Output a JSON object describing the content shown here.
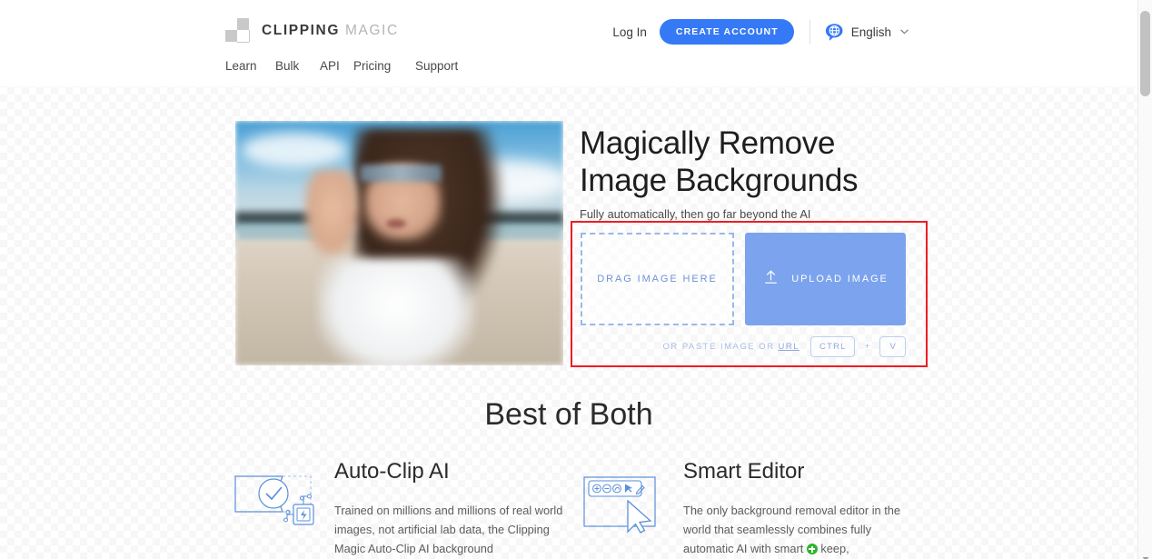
{
  "header": {
    "logo": {
      "bold": "CLIPPING",
      "light": "MAGIC",
      "icon": "checkerboard-logo-icon"
    },
    "nav": [
      {
        "label": "Learn"
      },
      {
        "label": "Bulk"
      },
      {
        "label": "API"
      },
      {
        "label": "Pricing"
      },
      {
        "label": "Support"
      }
    ],
    "login_label": "Log In",
    "create_account_label": "CREATE ACCOUNT",
    "language": {
      "label": "English",
      "icon": "globe-speech-bubble-icon",
      "caret": "∨"
    }
  },
  "hero": {
    "photo_alt": "woman-on-beach-photo",
    "title_line1": "Magically Remove",
    "title_line2": "Image Backgrounds",
    "subtitle": "Fully automatically, then go far beyond the AI"
  },
  "uploader": {
    "drag_label": "DRAG IMAGE HERE",
    "upload_label": "UPLOAD IMAGE",
    "upload_icon": "upload-arrow-icon",
    "paste_text": "OR PASTE IMAGE OR",
    "paste_url_label": "URL",
    "key_ctrl": "CTRL",
    "key_plus": "+",
    "key_v": "V",
    "highlight_color": "#ee1c25",
    "accent_color": "#7ba3ee"
  },
  "section": {
    "title": "Best of Both",
    "cards": [
      {
        "icon": "auto-clip-ai-icon",
        "title": "Auto-Clip AI",
        "body": "Trained on millions and millions of real world images, not artificial lab data, the Clipping Magic Auto-Clip AI background"
      },
      {
        "icon": "smart-editor-icon",
        "title": "Smart Editor",
        "body_before": "The only background removal editor in the world that seamlessly combines fully automatic AI with smart",
        "body_after": "keep,",
        "inline_icon": "green-plus-keep-icon"
      }
    ]
  },
  "scrollbar": {
    "name": "vertical-scrollbar"
  }
}
